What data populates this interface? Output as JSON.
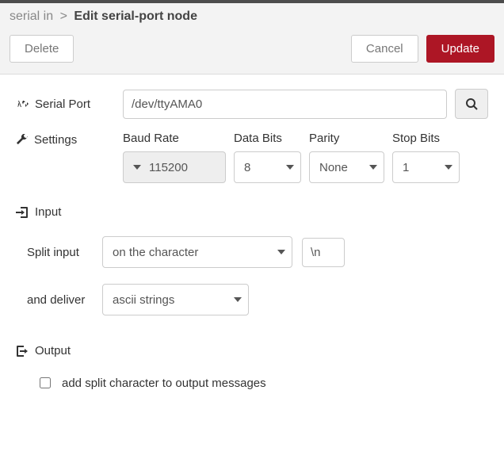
{
  "breadcrumb": {
    "parent": "serial in",
    "current": "Edit serial-port node"
  },
  "buttons": {
    "delete": "Delete",
    "cancel": "Cancel",
    "update": "Update"
  },
  "serialPort": {
    "label": "Serial Port",
    "value": "/dev/ttyAMA0"
  },
  "settings": {
    "label": "Settings",
    "baud": {
      "header": "Baud Rate",
      "value": "115200"
    },
    "dataBits": {
      "header": "Data Bits",
      "value": "8"
    },
    "parity": {
      "header": "Parity",
      "value": "None"
    },
    "stopBits": {
      "header": "Stop Bits",
      "value": "1"
    }
  },
  "input": {
    "header": "Input",
    "splitLabel": "Split input",
    "splitMode": "on the character",
    "splitChar": "\\n",
    "deliverLabel": "and deliver",
    "deliverMode": "ascii strings"
  },
  "output": {
    "header": "Output",
    "addSplitLabel": "add split character to output messages",
    "addSplitChecked": false
  }
}
